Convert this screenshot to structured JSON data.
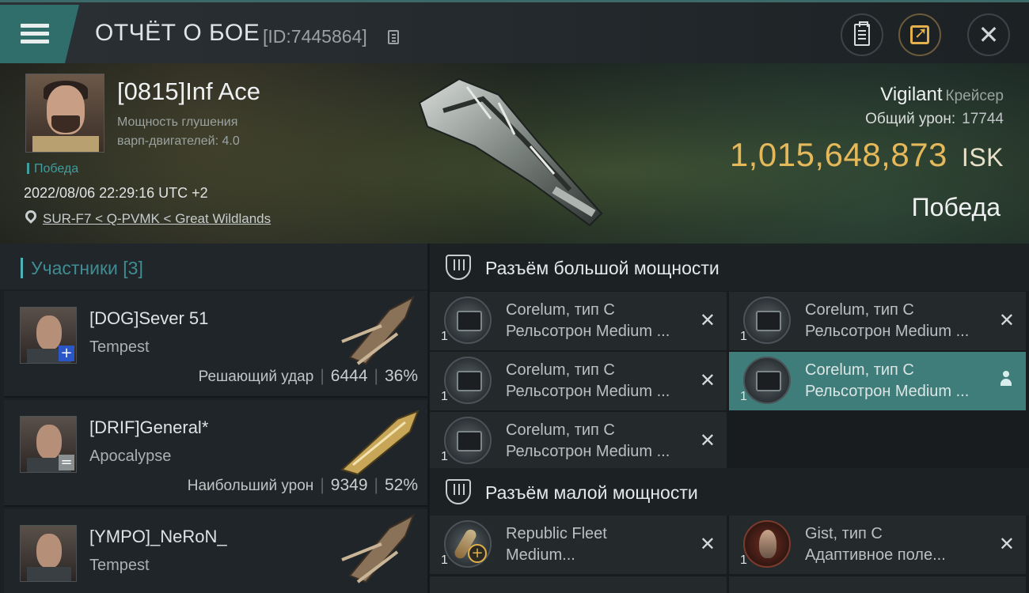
{
  "header": {
    "title": "ОТЧЁТ О БОЕ",
    "report_id": "[ID:7445864]"
  },
  "victim": {
    "pilot_name": "[0815]Inf Ace",
    "stat_line1": "Мощность глушения",
    "stat_line2": "варп-двигателей: 4.0",
    "victory_tag": "Победа",
    "datetime": "2022/08/06 22:29:16 UTC +2",
    "location": "SUR-F7 < Q-PVMK < Great Wildlands",
    "ship_name": "Vigilant",
    "ship_class": "Крейсер",
    "total_damage_label": "Общий урон:",
    "total_damage_value": "17744",
    "isk_value": "1,015,648,873",
    "isk_unit": "ISK",
    "result": "Победа"
  },
  "participants": {
    "header": "Участники [3]",
    "items": [
      {
        "name": "[DOG]Sever 51",
        "ship": "Tempest",
        "role": "Решающий удар",
        "damage": "6444",
        "percent": "36%",
        "badge": "+"
      },
      {
        "name": "[DRIF]General*",
        "ship": "Apocalypse",
        "role": "Наибольший урон",
        "damage": "9349",
        "percent": "52%",
        "badge": "="
      },
      {
        "name": "[YMPO]_NeRoN_",
        "ship": "Tempest",
        "role": "",
        "damage": "",
        "percent": "",
        "badge": ""
      }
    ]
  },
  "fitting": {
    "high_title": "Разъём большой мощности",
    "low_title": "Разъём малой мощности",
    "high_modules": [
      {
        "qty": "1",
        "line1": "Corelum, тип C",
        "line2": "Рельсотрон Medium ..."
      },
      {
        "qty": "1",
        "line1": "Corelum, тип C",
        "line2": "Рельсотрон Medium ..."
      },
      {
        "qty": "1",
        "line1": "Corelum, тип C",
        "line2": "Рельсотрон Medium ..."
      },
      {
        "qty": "1",
        "line1": "Corelum, тип C",
        "line2": "Рельсотрон Medium ..."
      },
      {
        "qty": "1",
        "line1": "Corelum, тип C",
        "line2": "Рельсотрон Medium ..."
      }
    ],
    "low_modules": [
      {
        "qty": "1",
        "line1": "Republic Fleet",
        "line2": "Medium..."
      },
      {
        "qty": "1",
        "line1": "Gist, тип C",
        "line2": "Адаптивное поле..."
      }
    ]
  }
}
